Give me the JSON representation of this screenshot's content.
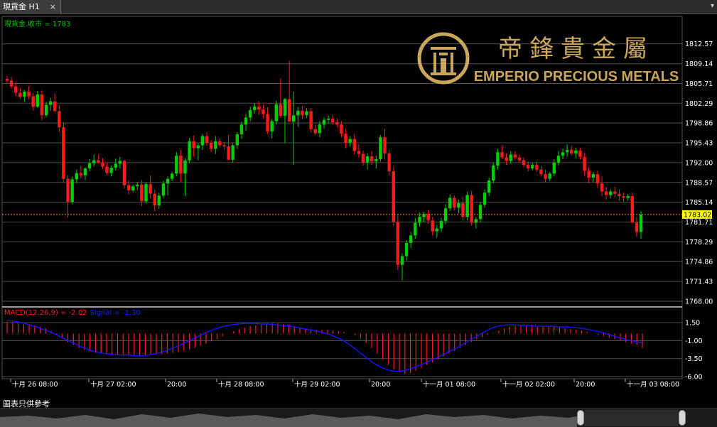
{
  "tab": {
    "title": "現貨金 H1",
    "close": "×",
    "menu": "▾"
  },
  "chart_data": {
    "type": "candlestick",
    "series_label": "現貨金.收市 = 1783",
    "current_price": "1783.02",
    "y_ticks": [
      "1812.57",
      "1809.14",
      "1805.71",
      "1802.29",
      "1798.86",
      "1795.43",
      "1792.00",
      "1788.57",
      "1785.14",
      "1781.71",
      "1778.29",
      "1774.86",
      "1771.43",
      "1768.00"
    ],
    "ylim": [
      1768.0,
      1814.5
    ],
    "x_ticks": [
      "十月 26 08:00",
      "十月 27 02:00",
      "20:00",
      "十月 28 08:00",
      "十月 29 02:00",
      "20:00",
      "十一月 01 08:00",
      "十一月 02 02:00",
      "20:00",
      "十一月 03 08:00"
    ],
    "candles": [
      [
        1806.5,
        1807.0,
        1805.8,
        1806.2
      ],
      [
        1806.2,
        1806.8,
        1804.8,
        1805.2
      ],
      [
        1805.2,
        1806.0,
        1803.5,
        1804.1
      ],
      [
        1804.1,
        1805.0,
        1803.0,
        1803.4
      ],
      [
        1803.4,
        1804.6,
        1802.6,
        1804.3
      ],
      [
        1804.3,
        1805.2,
        1803.0,
        1803.5
      ],
      [
        1803.5,
        1804.0,
        1801.0,
        1801.7
      ],
      [
        1801.7,
        1804.4,
        1801.5,
        1803.8
      ],
      [
        1803.8,
        1804.5,
        1799.3,
        1800.2
      ],
      [
        1800.2,
        1802.5,
        1799.8,
        1802.0
      ],
      [
        1802.0,
        1803.2,
        1801.0,
        1802.6
      ],
      [
        1802.6,
        1804.0,
        1801.8,
        1800.9
      ],
      [
        1800.9,
        1802.0,
        1797.3,
        1798.1
      ],
      [
        1798.1,
        1799.0,
        1788.5,
        1789.2
      ],
      [
        1789.2,
        1789.8,
        1782.5,
        1785.2
      ],
      [
        1785.2,
        1789.6,
        1784.8,
        1789.1
      ],
      [
        1789.1,
        1790.8,
        1788.4,
        1790.2
      ],
      [
        1790.2,
        1791.4,
        1789.3,
        1789.8
      ],
      [
        1789.8,
        1791.2,
        1789.0,
        1791.0
      ],
      [
        1791.0,
        1792.6,
        1790.5,
        1791.9
      ],
      [
        1791.9,
        1793.4,
        1791.3,
        1792.4
      ],
      [
        1792.4,
        1793.3,
        1791.8,
        1792.0
      ],
      [
        1792.0,
        1792.8,
        1790.9,
        1791.3
      ],
      [
        1791.3,
        1792.0,
        1789.8,
        1790.2
      ],
      [
        1790.2,
        1791.5,
        1789.6,
        1791.1
      ],
      [
        1791.1,
        1792.7,
        1790.6,
        1791.8
      ],
      [
        1791.8,
        1793.0,
        1791.0,
        1792.3
      ],
      [
        1792.3,
        1792.5,
        1787.5,
        1788.1
      ],
      [
        1788.1,
        1789.0,
        1786.5,
        1787.2
      ],
      [
        1787.2,
        1788.2,
        1786.8,
        1787.9
      ],
      [
        1787.9,
        1788.6,
        1787.2,
        1788.2
      ],
      [
        1788.2,
        1789.0,
        1784.5,
        1785.3
      ],
      [
        1785.3,
        1788.6,
        1784.9,
        1788.3
      ],
      [
        1788.3,
        1789.8,
        1785.8,
        1786.6
      ],
      [
        1786.6,
        1787.3,
        1783.5,
        1784.6
      ],
      [
        1784.6,
        1786.8,
        1784.0,
        1786.3
      ],
      [
        1786.3,
        1788.9,
        1785.8,
        1788.4
      ],
      [
        1788.4,
        1789.6,
        1786.3,
        1789.2
      ],
      [
        1789.2,
        1790.4,
        1788.8,
        1790.1
      ],
      [
        1790.1,
        1793.8,
        1789.7,
        1793.2
      ],
      [
        1793.2,
        1794.2,
        1788.7,
        1790.1
      ],
      [
        1790.1,
        1792.8,
        1786.2,
        1792.4
      ],
      [
        1792.4,
        1796.3,
        1791.9,
        1795.7
      ],
      [
        1795.7,
        1796.7,
        1793.0,
        1794.5
      ],
      [
        1794.5,
        1795.4,
        1792.4,
        1795.0
      ],
      [
        1795.0,
        1797.0,
        1794.2,
        1796.6
      ],
      [
        1796.6,
        1797.3,
        1794.9,
        1795.4
      ],
      [
        1795.4,
        1795.9,
        1793.8,
        1794.4
      ],
      [
        1794.4,
        1796.6,
        1793.5,
        1795.7
      ],
      [
        1795.7,
        1796.2,
        1794.7,
        1795.0
      ],
      [
        1795.0,
        1795.6,
        1794.3,
        1794.8
      ],
      [
        1794.8,
        1796.8,
        1793.8,
        1792.5
      ],
      [
        1792.5,
        1795.4,
        1792.0,
        1795.0
      ],
      [
        1795.0,
        1797.3,
        1794.4,
        1796.9
      ],
      [
        1796.9,
        1799.1,
        1796.1,
        1798.6
      ],
      [
        1798.6,
        1800.4,
        1797.5,
        1799.8
      ],
      [
        1799.8,
        1801.7,
        1799.1,
        1801.1
      ],
      [
        1801.1,
        1802.3,
        1800.5,
        1801.7
      ],
      [
        1801.7,
        1802.6,
        1800.3,
        1801.2
      ],
      [
        1801.2,
        1802.0,
        1799.7,
        1800.4
      ],
      [
        1800.4,
        1801.6,
        1797.0,
        1797.4
      ],
      [
        1797.4,
        1799.6,
        1796.2,
        1799.2
      ],
      [
        1799.2,
        1802.7,
        1798.6,
        1802.1
      ],
      [
        1802.1,
        1806.6,
        1799.7,
        1800.1
      ],
      [
        1800.1,
        1803.2,
        1795.4,
        1803.0
      ],
      [
        1803.0,
        1809.6,
        1801.6,
        1799.1
      ],
      [
        1799.1,
        1804.3,
        1791.6,
        1800.2
      ],
      [
        1800.2,
        1801.6,
        1798.2,
        1801.0
      ],
      [
        1801.0,
        1801.8,
        1799.5,
        1800.2
      ],
      [
        1800.2,
        1801.4,
        1799.7,
        1800.9
      ],
      [
        1800.9,
        1801.5,
        1797.2,
        1797.8
      ],
      [
        1797.8,
        1798.6,
        1796.8,
        1797.1
      ],
      [
        1797.1,
        1799.2,
        1796.4,
        1798.6
      ],
      [
        1798.6,
        1799.8,
        1797.9,
        1799.4
      ],
      [
        1799.4,
        1800.2,
        1798.8,
        1799.6
      ],
      [
        1799.6,
        1800.3,
        1798.6,
        1799.0
      ],
      [
        1799.0,
        1799.7,
        1798.1,
        1798.6
      ],
      [
        1798.6,
        1799.2,
        1796.4,
        1797.0
      ],
      [
        1797.0,
        1797.8,
        1794.5,
        1795.4
      ],
      [
        1795.4,
        1796.6,
        1794.8,
        1796.1
      ],
      [
        1796.1,
        1797.0,
        1793.4,
        1794.0
      ],
      [
        1794.0,
        1795.2,
        1792.8,
        1793.5
      ],
      [
        1793.5,
        1794.1,
        1791.5,
        1792.0
      ],
      [
        1792.0,
        1793.6,
        1790.8,
        1793.1
      ],
      [
        1793.1,
        1794.0,
        1791.6,
        1792.2
      ],
      [
        1792.2,
        1793.2,
        1791.0,
        1792.6
      ],
      [
        1792.6,
        1796.8,
        1792.2,
        1796.4
      ],
      [
        1796.4,
        1797.8,
        1792.5,
        1793.6
      ],
      [
        1793.6,
        1794.2,
        1789.8,
        1790.5
      ],
      [
        1790.5,
        1791.3,
        1781.0,
        1781.8
      ],
      [
        1781.8,
        1783.0,
        1773.4,
        1774.3
      ],
      [
        1774.3,
        1776.3,
        1771.6,
        1775.8
      ],
      [
        1775.8,
        1778.6,
        1775.0,
        1778.1
      ],
      [
        1778.1,
        1780.0,
        1777.2,
        1779.4
      ],
      [
        1779.4,
        1782.4,
        1778.8,
        1781.6
      ],
      [
        1781.6,
        1783.4,
        1780.9,
        1782.6
      ],
      [
        1782.6,
        1783.5,
        1781.7,
        1783.1
      ],
      [
        1783.1,
        1783.8,
        1781.4,
        1782.0
      ],
      [
        1782.0,
        1782.6,
        1779.4,
        1780.1
      ],
      [
        1780.1,
        1781.2,
        1779.0,
        1780.6
      ],
      [
        1780.6,
        1782.4,
        1780.0,
        1781.9
      ],
      [
        1781.9,
        1784.8,
        1781.3,
        1784.1
      ],
      [
        1784.1,
        1786.5,
        1783.6,
        1785.9
      ],
      [
        1785.9,
        1786.3,
        1783.7,
        1784.2
      ],
      [
        1784.2,
        1785.6,
        1783.2,
        1785.0
      ],
      [
        1785.0,
        1786.0,
        1782.0,
        1782.6
      ],
      [
        1782.6,
        1787.0,
        1782.0,
        1786.4
      ],
      [
        1786.4,
        1787.1,
        1781.1,
        1781.6
      ],
      [
        1781.6,
        1782.6,
        1780.6,
        1782.2
      ],
      [
        1782.2,
        1785.2,
        1781.6,
        1784.7
      ],
      [
        1784.7,
        1787.4,
        1784.2,
        1786.8
      ],
      [
        1786.8,
        1789.4,
        1786.2,
        1788.9
      ],
      [
        1788.9,
        1792.0,
        1788.4,
        1791.5
      ],
      [
        1791.5,
        1794.4,
        1790.8,
        1793.8
      ],
      [
        1793.8,
        1795.0,
        1792.6,
        1792.9
      ],
      [
        1792.9,
        1793.6,
        1791.6,
        1792.3
      ],
      [
        1792.3,
        1794.0,
        1791.8,
        1793.4
      ],
      [
        1793.4,
        1794.0,
        1792.5,
        1792.9
      ],
      [
        1792.9,
        1793.4,
        1791.9,
        1792.4
      ],
      [
        1792.4,
        1792.9,
        1791.2,
        1791.6
      ],
      [
        1791.6,
        1792.2,
        1790.5,
        1791.0
      ],
      [
        1791.0,
        1792.0,
        1790.6,
        1791.6
      ],
      [
        1791.6,
        1792.2,
        1790.4,
        1790.8
      ],
      [
        1790.8,
        1791.4,
        1789.6,
        1790.0
      ],
      [
        1790.0,
        1790.8,
        1788.6,
        1789.2
      ],
      [
        1789.2,
        1790.4,
        1788.8,
        1790.1
      ],
      [
        1790.1,
        1792.6,
        1789.6,
        1792.0
      ],
      [
        1792.0,
        1794.0,
        1791.5,
        1793.2
      ],
      [
        1793.2,
        1794.4,
        1792.6,
        1793.8
      ],
      [
        1793.8,
        1795.2,
        1793.0,
        1794.2
      ],
      [
        1794.2,
        1795.0,
        1793.2,
        1793.6
      ],
      [
        1793.6,
        1794.6,
        1792.8,
        1794.1
      ],
      [
        1794.1,
        1794.6,
        1792.5,
        1793.0
      ],
      [
        1793.0,
        1793.7,
        1789.8,
        1790.6
      ],
      [
        1790.6,
        1791.2,
        1788.4,
        1789.4
      ],
      [
        1789.4,
        1790.4,
        1788.6,
        1790.0
      ],
      [
        1790.0,
        1790.6,
        1787.6,
        1788.4
      ],
      [
        1788.4,
        1789.6,
        1786.2,
        1787.0
      ],
      [
        1787.0,
        1787.8,
        1785.6,
        1786.4
      ],
      [
        1786.4,
        1787.4,
        1785.8,
        1787.0
      ],
      [
        1787.0,
        1787.8,
        1786.0,
        1786.6
      ],
      [
        1786.6,
        1787.4,
        1785.4,
        1786.2
      ],
      [
        1786.2,
        1786.8,
        1785.2,
        1785.9
      ],
      [
        1785.9,
        1786.6,
        1785.4,
        1786.2
      ],
      [
        1786.2,
        1786.8,
        1784.2,
        1781.6
      ],
      [
        1781.6,
        1782.6,
        1779.2,
        1780.0
      ],
      [
        1780.0,
        1783.6,
        1778.8,
        1783.0
      ]
    ]
  },
  "macd": {
    "label": "MACD(12,26,9) = -2.02",
    "signal_label": "Signal = -1.30",
    "y_ticks": [
      "1.50",
      "-1.00",
      "-3.50",
      "-6.00"
    ],
    "ylim": [
      -6.0,
      2.5
    ],
    "hist": [
      1.6,
      1.6,
      1.4,
      1.3,
      1.2,
      1.1,
      0.9,
      0.7,
      0.3,
      -0.2,
      -0.7,
      -1.2,
      -1.6,
      -2.0,
      -2.3,
      -2.5,
      -2.7,
      -2.8,
      -2.9,
      -2.9,
      -3.0,
      -3.0,
      -3.0,
      -3.0,
      -3.0,
      -3.0,
      -2.9,
      -2.9,
      -2.9,
      -2.8,
      -2.7,
      -2.6,
      -2.4,
      -2.2,
      -2.0,
      -1.7,
      -1.4,
      -1.1,
      -0.8,
      -0.4,
      0.0,
      0.3,
      0.6,
      0.8,
      1.0,
      1.1,
      1.2,
      1.3,
      1.4,
      1.4,
      1.3,
      1.2,
      1.0,
      0.8,
      0.6,
      0.6,
      0.5,
      0.5,
      0.5,
      0.4,
      0.3,
      0.2,
      0.0,
      -0.3,
      -0.7,
      -1.3,
      -2.0,
      -2.8,
      -3.6,
      -4.4,
      -5.0,
      -5.4,
      -5.6,
      -5.5,
      -5.2,
      -4.8,
      -4.4,
      -4.0,
      -3.6,
      -3.2,
      -2.8,
      -2.4,
      -2.0,
      -1.6,
      -1.2,
      -0.8,
      -0.5,
      -0.2,
      0.1,
      0.4,
      0.7,
      0.9,
      1.0,
      1.1,
      1.1,
      1.0,
      0.9,
      0.9,
      0.9,
      0.9,
      0.8,
      0.7,
      0.6,
      0.5,
      0.4,
      0.2,
      0.0,
      -0.2,
      -0.4,
      -0.6,
      -0.8,
      -1.0,
      -1.2,
      -1.4,
      -1.6,
      -2.0
    ],
    "signal": [
      1.8,
      1.7,
      1.5,
      1.2,
      0.9,
      0.5,
      0.1,
      -0.4,
      -0.9,
      -1.4,
      -1.9,
      -2.3,
      -2.6,
      -2.8,
      -2.9,
      -3.0,
      -3.0,
      -3.1,
      -3.1,
      -3.0,
      -2.8,
      -2.5,
      -2.1,
      -1.7,
      -1.2,
      -0.7,
      -0.2,
      0.3,
      0.7,
      1.0,
      1.2,
      1.3,
      1.4,
      1.4,
      1.3,
      1.3,
      1.2,
      1.1,
      1.0,
      0.8,
      0.6,
      0.4,
      0.2,
      -0.1,
      -0.5,
      -1.0,
      -1.7,
      -2.5,
      -3.3,
      -4.1,
      -4.7,
      -5.1,
      -5.3,
      -5.2,
      -4.9,
      -4.5,
      -4.1,
      -3.6,
      -3.1,
      -2.6,
      -2.1,
      -1.5,
      -0.9,
      -0.3,
      0.3,
      0.8,
      1.1,
      1.2,
      1.2,
      1.1,
      1.1,
      1.0,
      1.0,
      1.0,
      0.9,
      0.9,
      0.8,
      0.7,
      0.5,
      0.3,
      0.0,
      -0.3,
      -0.6,
      -0.9,
      -1.1,
      -1.3
    ]
  },
  "watermark": {
    "logo_text": "帝鋒貴金屬",
    "tagline": "EMPERIO PRECIOUS METALS"
  },
  "footer": {
    "note": "圖表只供參考"
  },
  "colors": {
    "up": "#00d000",
    "down": "#ff1a1a",
    "grid": "#505050",
    "axis_text": "#ffffff",
    "price_line": "#ff8c00",
    "price_badge": "#ffff00",
    "signal": "#1414ff",
    "label_green": "#00c800",
    "gold": "#c9a65a"
  }
}
